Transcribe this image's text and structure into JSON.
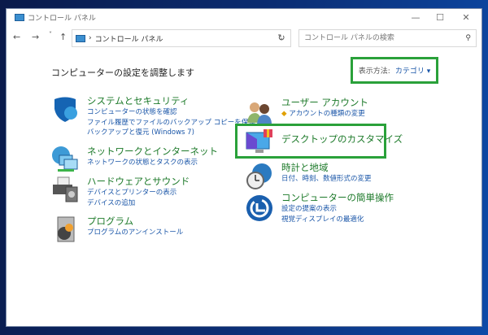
{
  "window": {
    "title": "コントロール パネル",
    "minimize": "—",
    "maximize": "☐",
    "close": "✕"
  },
  "nav": {
    "back": "←",
    "forward": "→",
    "recent": "˅",
    "up": "↑",
    "separator": "›",
    "address": "コントロール パネル",
    "address_dropdown": "⌄",
    "refresh": "↻",
    "search_placeholder": "コントロール パネルの検索",
    "search_icon": "⚲"
  },
  "heading": "コンピューターの設定を調整します",
  "view_by": {
    "label": "表示方法:",
    "value": "カテゴリ",
    "arrow": "▾"
  },
  "left": [
    {
      "title": "システムとセキュリティ",
      "links": [
        "コンピューターの状態を確認",
        "ファイル履歴でファイルのバックアップ コピーを保存",
        "バックアップと復元 (Windows 7)"
      ]
    },
    {
      "title": "ネットワークとインターネット",
      "links": [
        "ネットワークの状態とタスクの表示"
      ]
    },
    {
      "title": "ハードウェアとサウンド",
      "links": [
        "デバイスとプリンターの表示",
        "デバイスの追加"
      ]
    },
    {
      "title": "プログラム",
      "links": [
        "プログラムのアンインストール"
      ]
    }
  ],
  "right": [
    {
      "title": "ユーザー アカウント",
      "links": [
        "アカウントの種類の変更"
      ]
    },
    {
      "title": "デスクトップのカスタマイズ",
      "links": []
    },
    {
      "title": "時計と地域",
      "links": [
        "日付、時刻、数値形式の変更"
      ]
    },
    {
      "title": "コンピューターの簡単操作",
      "links": [
        "設定の提案の表示",
        "視覚ディスプレイの最適化"
      ]
    }
  ],
  "colors": {
    "highlight": "#2aa13a",
    "category": "#1d7a2a",
    "link": "#1a56a8"
  }
}
